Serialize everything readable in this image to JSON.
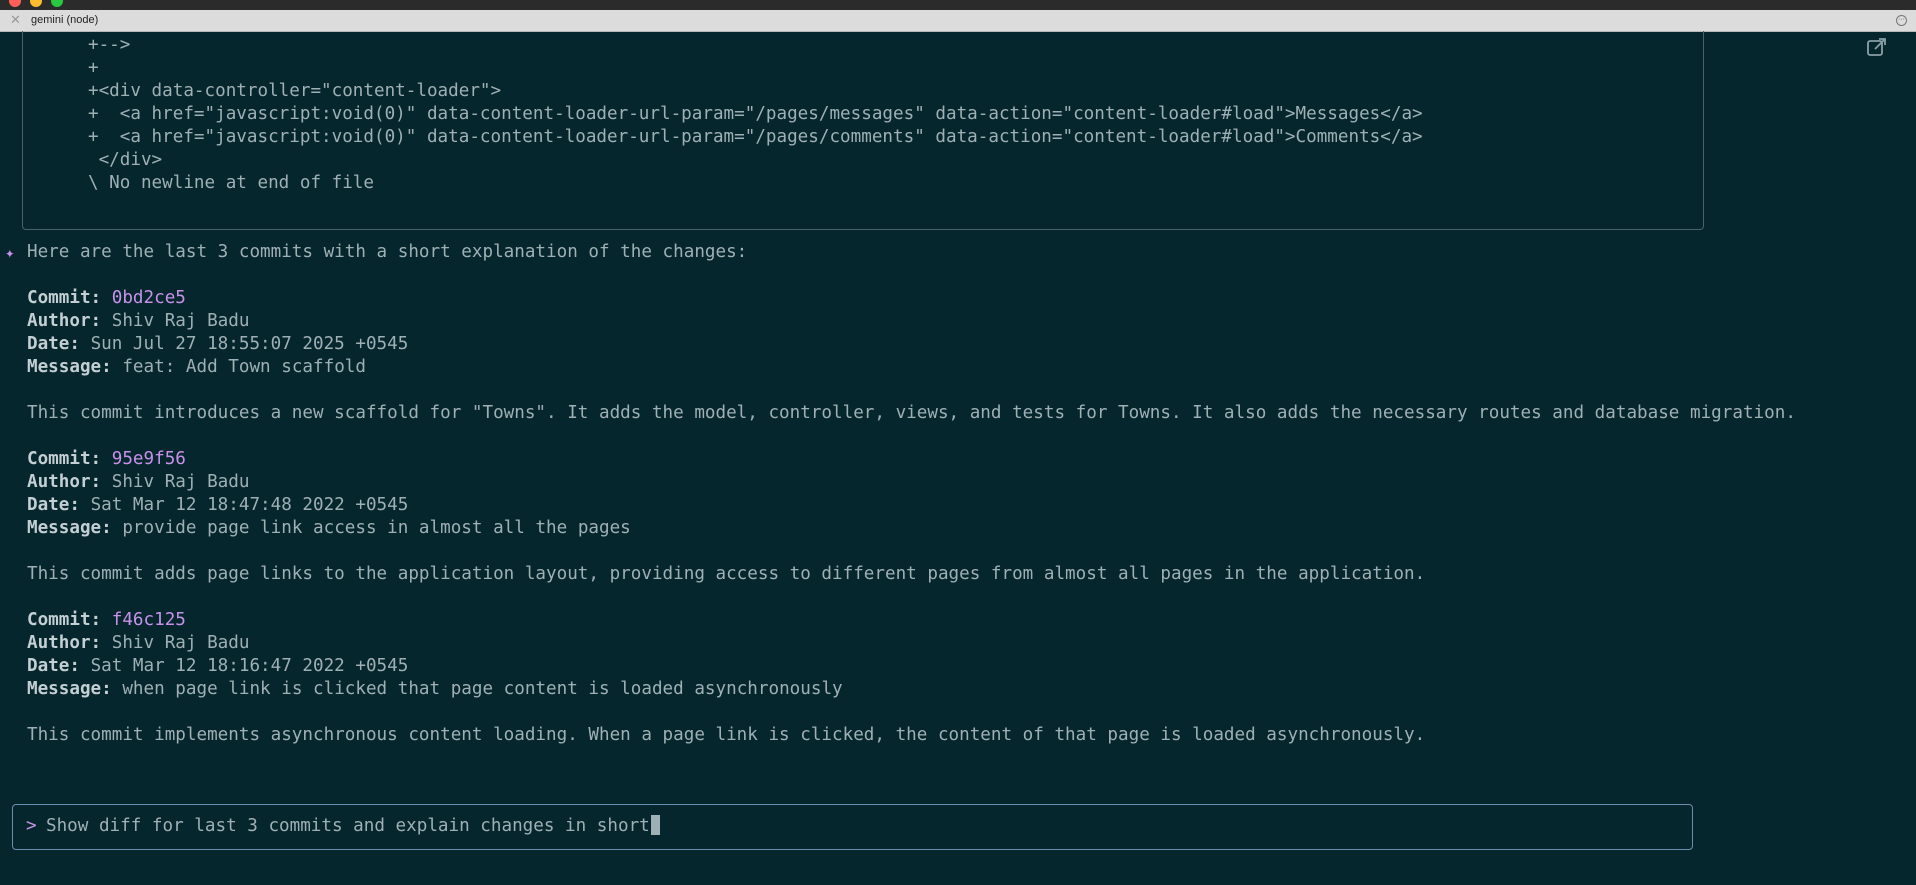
{
  "window": {
    "tab_title": "gemini (node)"
  },
  "diff_lines": [
    "+-->",
    "+",
    "+<div data-controller=\"content-loader\">",
    "+  <a href=\"javascript:void(0)\" data-content-loader-url-param=\"/pages/messages\" data-action=\"content-loader#load\">Messages</a>",
    "+  <a href=\"javascript:void(0)\" data-content-loader-url-param=\"/pages/comments\" data-action=\"content-loader#load\">Comments</a>",
    " </div>",
    "\\ No newline at end of file"
  ],
  "response": {
    "intro": "Here are the last 3 commits with a short explanation of the changes:",
    "labels": {
      "commit": "Commit:",
      "author": "Author:",
      "date": "Date:",
      "message": "Message:"
    },
    "commits": [
      {
        "hash": "0bd2ce5",
        "author": "Shiv Raj Badu",
        "date": "Sun Jul 27 18:55:07 2025 +0545",
        "message": "feat: Add Town scaffold",
        "explanation": "This commit introduces a new scaffold for \"Towns\". It adds the model, controller, views, and tests for Towns. It also adds the necessary routes and database migration."
      },
      {
        "hash": "95e9f56",
        "author": "Shiv Raj Badu",
        "date": "Sat Mar 12 18:47:48 2022 +0545",
        "message": "provide page link access in almost all the pages",
        "explanation": "This commit adds page links to the application layout, providing access to different pages from almost all pages in the application."
      },
      {
        "hash": "f46c125",
        "author": "Shiv Raj Badu",
        "date": "Sat Mar 12 18:16:47 2022 +0545",
        "message": "when page link is clicked that page content is loaded asynchronously",
        "explanation": "This commit implements asynchronous content loading. When a page link is clicked, the content of that page is loaded asynchronously."
      }
    ]
  },
  "input": {
    "prompt_symbol": ">",
    "value": "Show diff for last 3 commits and explain changes in short"
  }
}
